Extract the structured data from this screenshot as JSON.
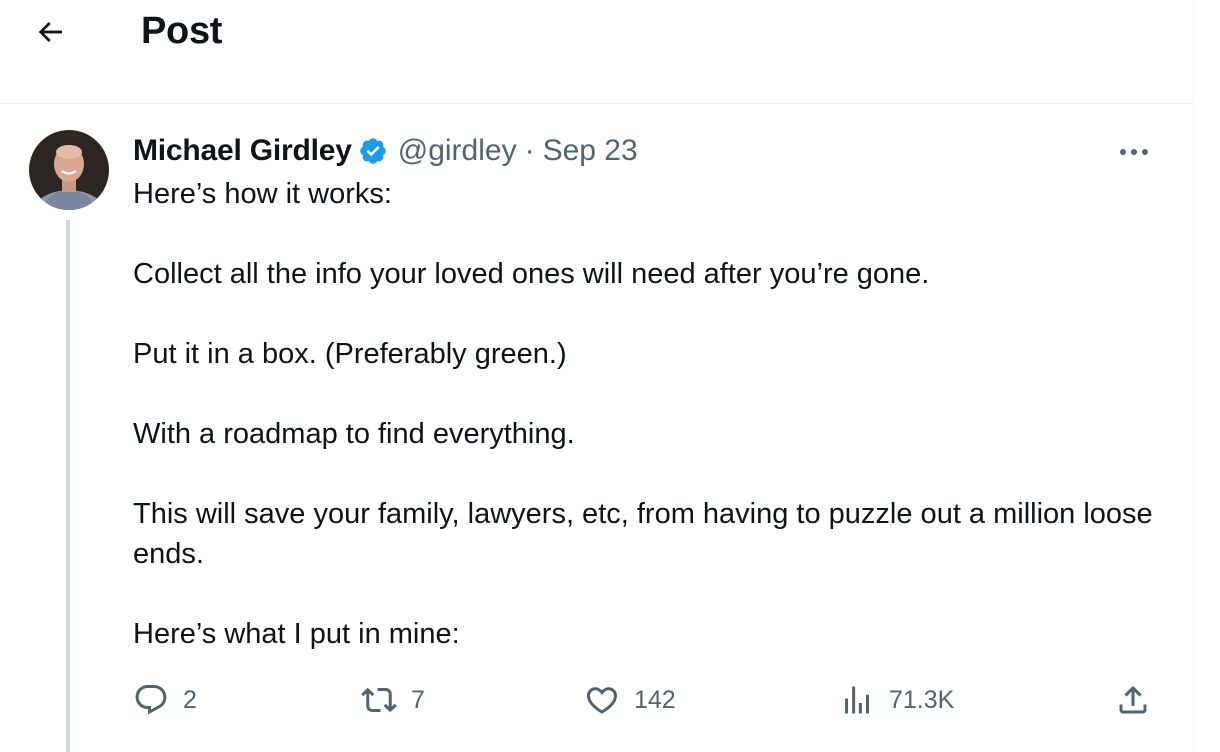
{
  "header": {
    "title": "Post"
  },
  "author": {
    "name": "Michael Girdley",
    "handle": "@girdley",
    "separator": "·",
    "date": "Sep 23"
  },
  "tweet": {
    "paragraphs": [
      "Here’s how it works:",
      "Collect all the info your loved ones will need after you’re gone.",
      "Put it in a box. (Preferably green.)",
      "With a roadmap to find everything.",
      "This will save your family, lawyers, etc, from having to puzzle out a million loose ends.",
      "Here’s what I put in mine:"
    ]
  },
  "actions": {
    "replies": "2",
    "reposts": "7",
    "likes": "142",
    "views": "71.3K"
  },
  "icons": {
    "back": "arrow-left-icon",
    "verified": "verified-badge-icon",
    "more": "more-dots-icon",
    "reply": "reply-bubble-icon",
    "repost": "repost-arrows-icon",
    "like": "heart-icon",
    "views": "bar-chart-icon",
    "share": "share-upload-icon"
  },
  "colors": {
    "text": "#0f1419",
    "secondary": "#536471",
    "verified": "#1d9bf0",
    "border": "#eff3f4",
    "thread": "#cfd9de"
  }
}
